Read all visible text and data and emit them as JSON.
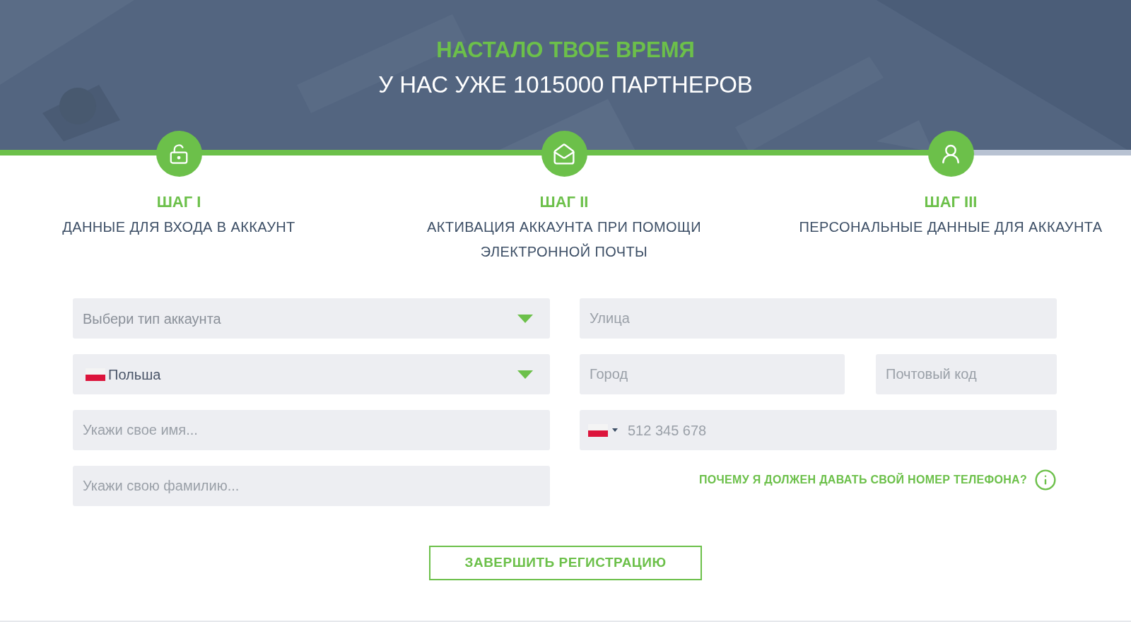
{
  "header": {
    "title": "НАСТАЛО ТВОЕ ВРЕМЯ",
    "subtitle": "У НАС УЖЕ 1015000 ПАРТНЕРОВ"
  },
  "progress": {
    "level": 0.86
  },
  "steps": [
    {
      "kind": "lock",
      "title": "ШАГ I",
      "description": "ДАННЫЕ ДЛЯ ВХОДА В АККАУНТ"
    },
    {
      "kind": "mail",
      "title": "ШАГ II",
      "description": "АКТИВАЦИЯ АККАУНТА ПРИ ПОМОЩИ ЭЛЕКТРОННОЙ ПОЧТЫ"
    },
    {
      "kind": "person",
      "title": "ШАГ III",
      "description": "ПЕРСОНАЛЬНЫЕ ДАННЫЕ ДЛЯ АККАУНТА"
    }
  ],
  "form": {
    "account_type": {
      "placeholder": "Выбери тип аккаунта"
    },
    "country": {
      "value": "Польша"
    },
    "first_name": {
      "placeholder": "Укажи свое имя..."
    },
    "last_name": {
      "placeholder": "Укажи свою фамилию..."
    },
    "street": {
      "placeholder": "Улица"
    },
    "city": {
      "placeholder": "Город"
    },
    "postal_code": {
      "placeholder": "Почтовый код"
    },
    "phone": {
      "placeholder": "512 345 678"
    },
    "phone_help": "ПОЧЕМУ Я ДОЛЖЕН ДАВАТЬ СВОЙ НОМЕР ТЕЛЕФОНА?",
    "submit": "ЗАВЕРШИТЬ РЕГИСТРАЦИЮ"
  }
}
